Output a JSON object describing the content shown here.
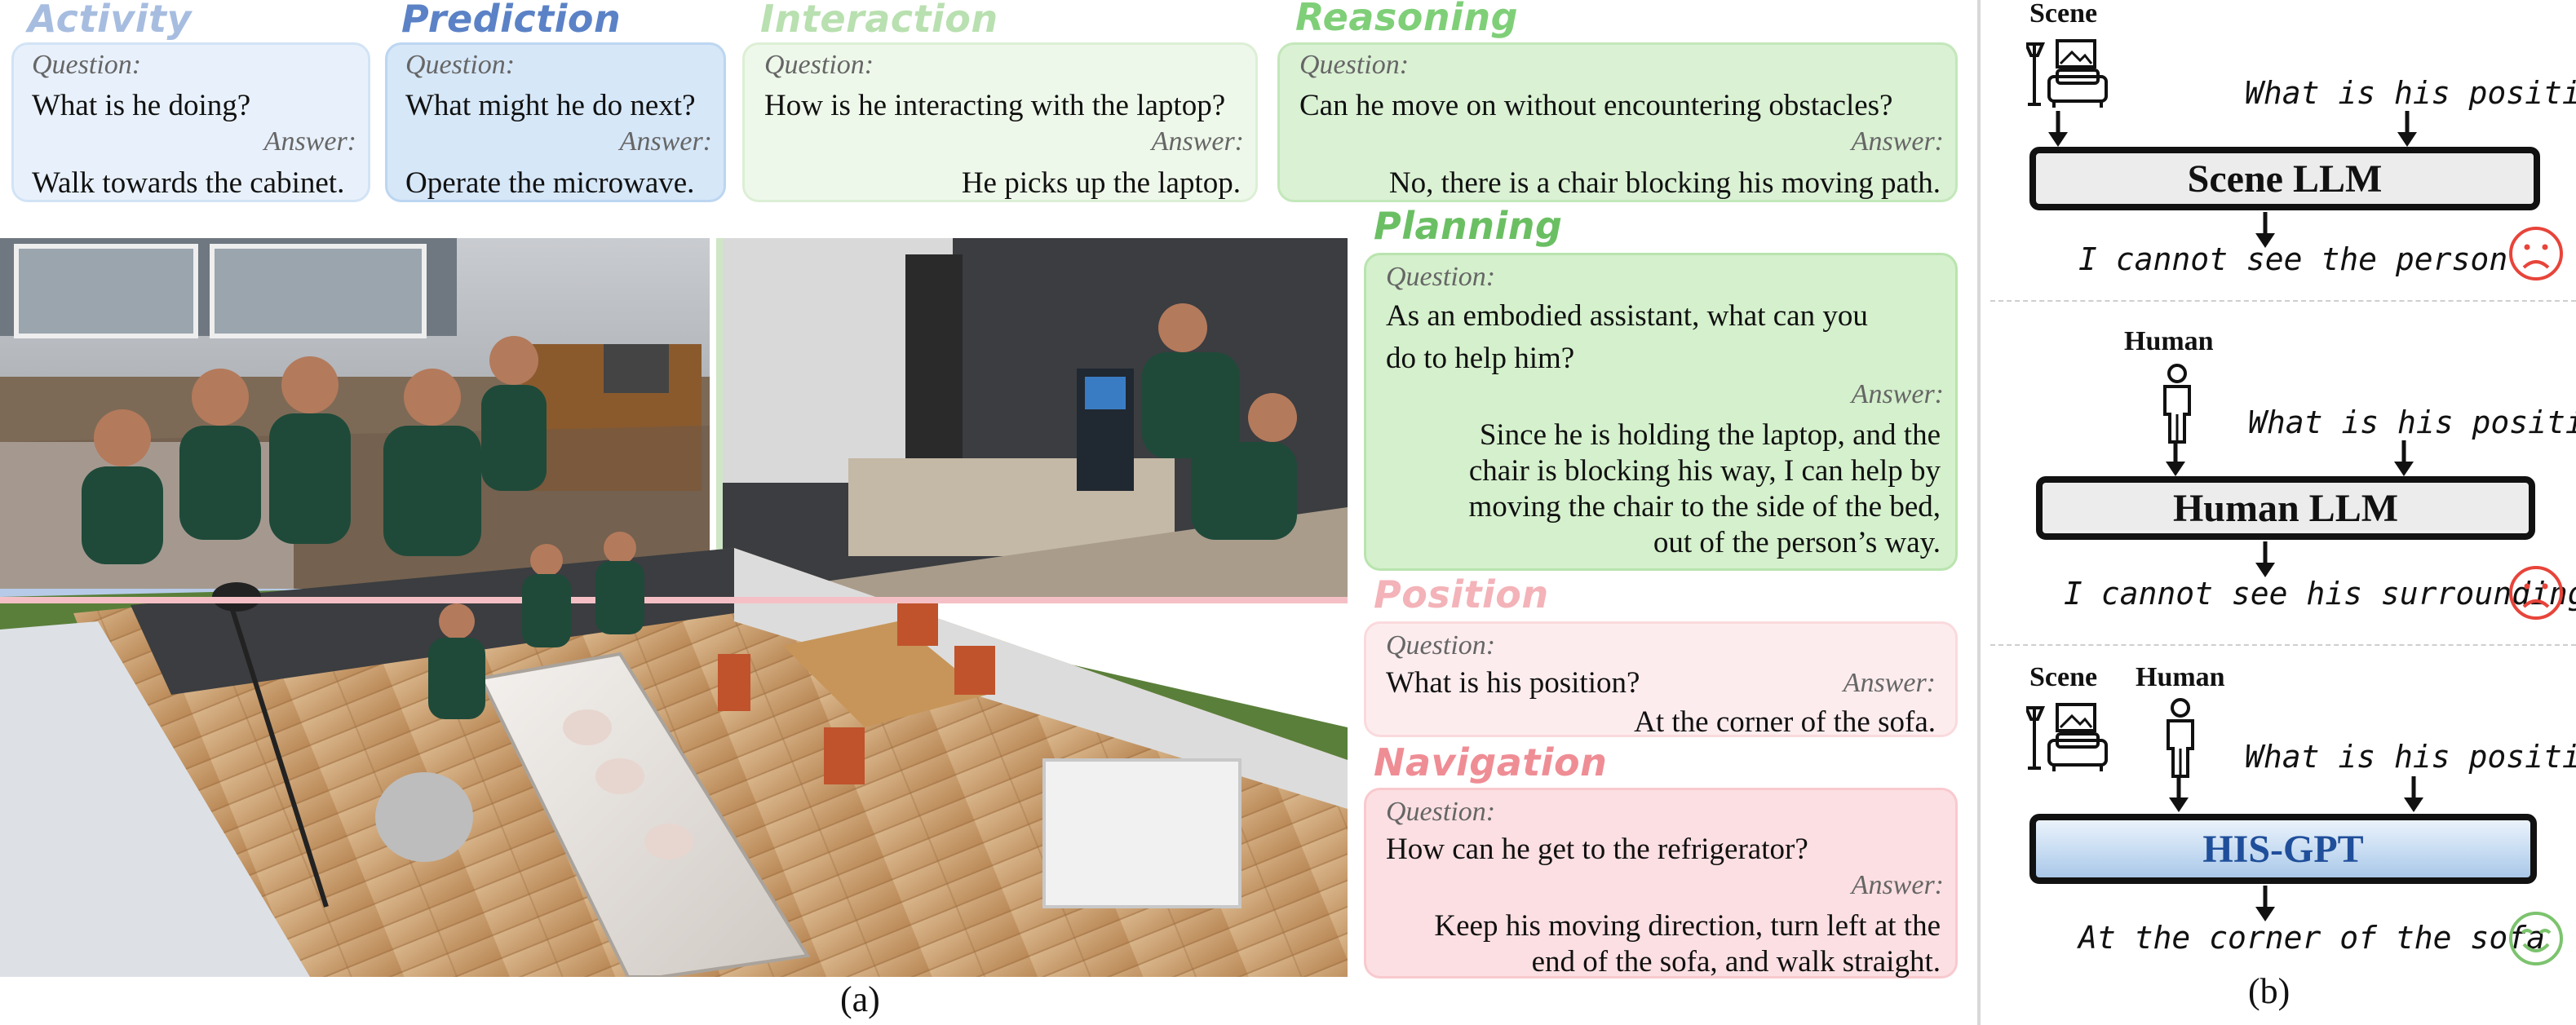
{
  "panel_a": {
    "caption": "(a)",
    "cards": {
      "activity": {
        "category": "Activity",
        "q_label": "Question:",
        "a_label": "Answer:",
        "question": "What is he doing?",
        "answer": "Walk towards the cabinet.",
        "color": "#a7bde0"
      },
      "prediction": {
        "category": "Prediction",
        "q_label": "Question:",
        "a_label": "Answer:",
        "question": "What might he do next?",
        "answer": "Operate the microwave.",
        "color": "#5b82c6"
      },
      "interaction": {
        "category": "Interaction",
        "q_label": "Question:",
        "a_label": "Answer:",
        "question": "How is he interacting with the laptop?",
        "answer": "He picks up the laptop.",
        "color": "#b9e0b0"
      },
      "reasoning": {
        "category": "Reasoning",
        "q_label": "Question:",
        "a_label": "Answer:",
        "question": "Can he move on without encountering obstacles?",
        "answer": "No, there is a chair blocking his moving path.",
        "color": "#7fcf78"
      },
      "planning": {
        "category": "Planning",
        "q_label": "Question:",
        "a_label": "Answer:",
        "question_lines": [
          "As an embodied assistant, what can you",
          "do to help him?"
        ],
        "answer_lines": [
          "Since he is holding the laptop, and the",
          "chair is blocking his way, I can help by",
          "moving the chair to the side of the bed,",
          "out of the person’s way."
        ],
        "color": "#6bbf63"
      },
      "position": {
        "category": "Position",
        "q_label": "Question:",
        "a_label": "Answer:",
        "question": "What is his position?",
        "answer": "At the corner of the sofa.",
        "color": "#f3b3b8"
      },
      "navigation": {
        "category": "Navigation",
        "q_label": "Question:",
        "a_label": "Answer:",
        "question": "How can he get to the refrigerator?",
        "answer_lines": [
          "Keep his moving direction, turn left at the",
          "end of the sofa, and walk straight."
        ],
        "color": "#ef8d95"
      }
    }
  },
  "panel_b": {
    "caption": "(b)",
    "rows": [
      {
        "inputs_label": "Scene",
        "query": "What is his position?",
        "model": "Scene LLM",
        "response": "I cannot see the person",
        "face": "sad",
        "face_color": "#e8443a"
      },
      {
        "inputs_label": "Human",
        "query": "What is his position?",
        "model": "Human LLM",
        "response": "I cannot see his surroundings",
        "face": "sad",
        "face_color": "#e8443a"
      },
      {
        "scene_label": "Scene",
        "human_label": "Human",
        "query": "What is his position?",
        "model": "HIS-GPT",
        "response": "At the corner of the sofa",
        "face": "happy",
        "face_color": "#7cc36e"
      }
    ],
    "model_colors": {
      "his_gpt_text": "#1f4e9a",
      "his_gpt_fill": "#c7dcf2"
    }
  }
}
